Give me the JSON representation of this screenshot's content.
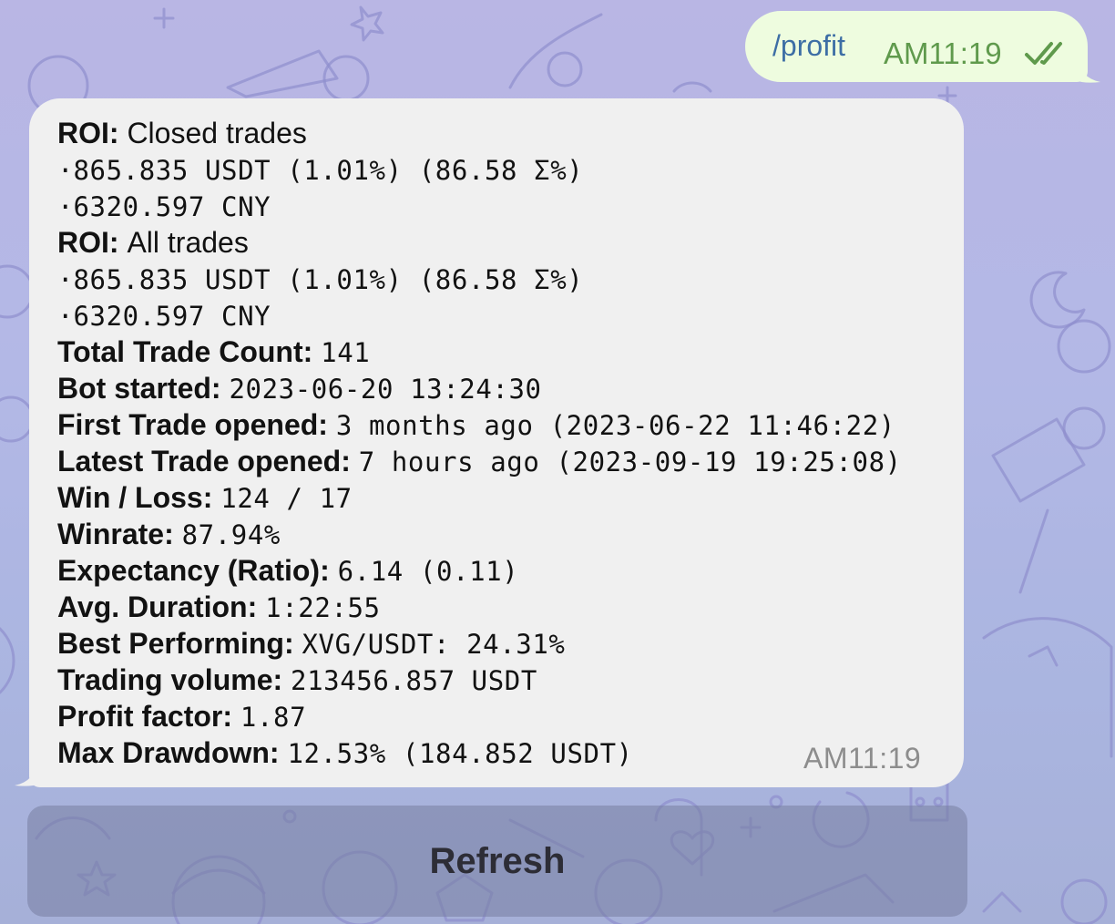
{
  "outgoing": {
    "command": "/profit",
    "time": "AM11:19",
    "status_icon": "double-check-icon",
    "color": "#eefcdf"
  },
  "incoming": {
    "time": "AM11:19",
    "lines": [
      {
        "label": "ROI:",
        "value": "Closed trades",
        "kind": "plain"
      },
      {
        "bullet": "·",
        "value": "865.835 USDT (1.01%) (86.58 Σ%)"
      },
      {
        "bullet": "·",
        "value": "6320.597 CNY"
      },
      {
        "label": "ROI:",
        "value": "All trades",
        "kind": "plain"
      },
      {
        "bullet": "·",
        "value": "865.835 USDT (1.01%) (86.58 Σ%)"
      },
      {
        "bullet": "·",
        "value": "6320.597 CNY"
      },
      {
        "label": "Total Trade Count:",
        "value": "141"
      },
      {
        "label": "Bot started:",
        "value": "2023-06-20 13:24:30"
      },
      {
        "label": "First Trade opened:",
        "value": "3 months ago (2023-06-22 11:46:22)"
      },
      {
        "label": "Latest Trade opened:",
        "value": "7 hours ago (2023-09-19 19:25:08)"
      },
      {
        "label": "Win / Loss:",
        "value": "124 / 17"
      },
      {
        "label": "Winrate:",
        "value": "87.94%"
      },
      {
        "label": "Expectancy (Ratio):",
        "value": "6.14 (0.11)"
      },
      {
        "label": "Avg. Duration:",
        "value": "1:22:55"
      },
      {
        "label": "Best Performing:",
        "value": "XVG/USDT: 24.31%"
      },
      {
        "label": "Trading volume:",
        "value": "213456.857 USDT"
      },
      {
        "label": "Profit factor:",
        "value": "1.87"
      },
      {
        "label": "Max Drawdown:",
        "value": "12.53% (184.852 USDT)"
      }
    ]
  },
  "keyboard": {
    "refresh_label": "Refresh"
  },
  "colors": {
    "accent_blue": "#3d6ea5",
    "outgoing_time": "#5f9a4c",
    "incoming_bubble": "#f0f0f0"
  }
}
